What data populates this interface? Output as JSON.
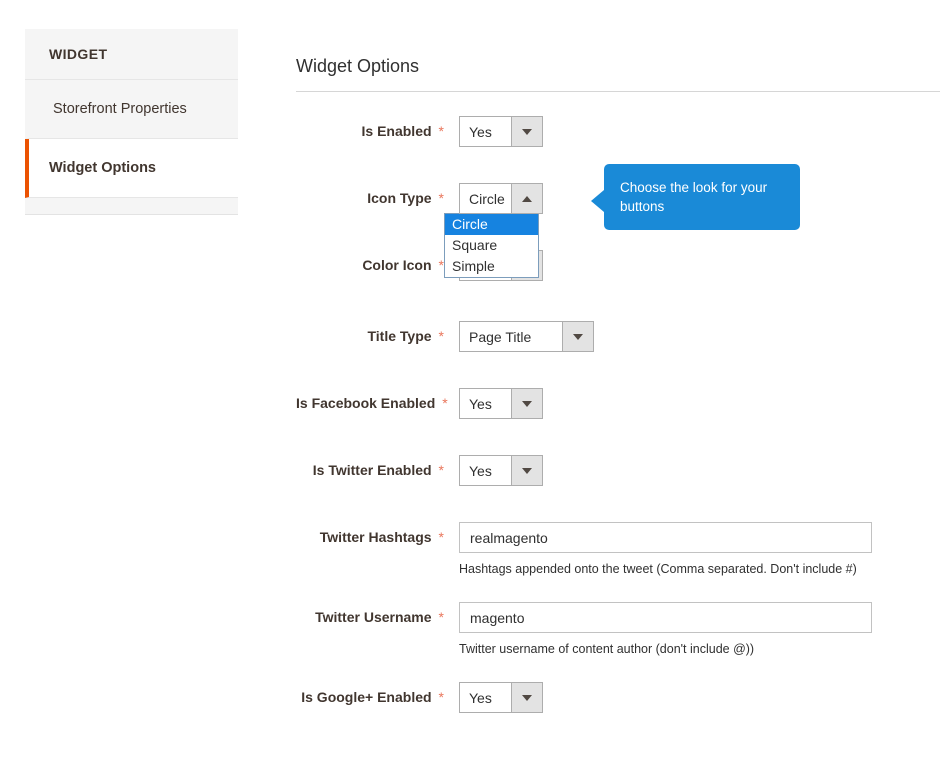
{
  "sidebar": {
    "header": "WIDGET",
    "items": [
      {
        "label": "Storefront Properties",
        "active": false
      },
      {
        "label": "Widget Options",
        "active": true
      }
    ]
  },
  "main": {
    "section_title": "Widget Options",
    "fields": {
      "is_enabled": {
        "label": "Is Enabled",
        "required": "*",
        "value": "Yes"
      },
      "icon_type": {
        "label": "Icon Type",
        "required": "*",
        "value": "Circle",
        "options": [
          "Circle",
          "Square",
          "Simple"
        ],
        "selected_option": "Circle"
      },
      "color_icon": {
        "label": "Color Icon",
        "required": "*",
        "value": ""
      },
      "title_type": {
        "label": "Title Type",
        "required": "*",
        "value": "Page Title"
      },
      "is_facebook_enabled": {
        "label": "Is Facebook Enabled",
        "required": "*",
        "value": "Yes"
      },
      "is_twitter_enabled": {
        "label": "Is Twitter Enabled",
        "required": "*",
        "value": "Yes"
      },
      "twitter_hashtags": {
        "label": "Twitter Hashtags",
        "required": "*",
        "value": "realmagento",
        "helper": "Hashtags appended onto the tweet (Comma separated. Don't include #)"
      },
      "twitter_username": {
        "label": "Twitter Username",
        "required": "*",
        "value": "magento",
        "helper": "Twitter username of content author (don't include @))"
      },
      "is_google_plus_enabled": {
        "label": "Is Google+ Enabled",
        "required": "*",
        "value": "Yes"
      }
    }
  },
  "tooltip": {
    "text": "Choose the look for your buttons"
  },
  "colors": {
    "accent_orange": "#eb5202",
    "required_star": "#e9755b",
    "tooltip_blue": "#1a8ad7",
    "option_highlight": "#1683e0"
  }
}
